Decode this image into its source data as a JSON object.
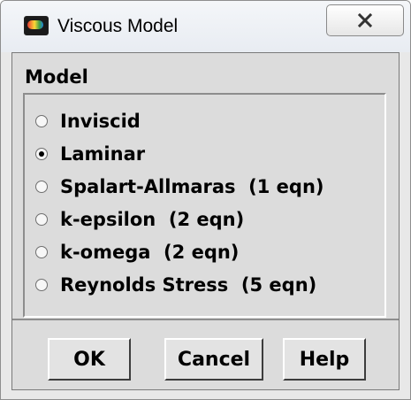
{
  "window": {
    "title": "Viscous Model",
    "close_symbol": "☒"
  },
  "model": {
    "label": "Model",
    "selected": "Laminar",
    "options": [
      {
        "label": "Inviscid",
        "checked": false
      },
      {
        "label": "Laminar",
        "checked": true
      },
      {
        "label": "Spalart-Allmaras  (1 eqn)",
        "checked": false
      },
      {
        "label": "k-epsilon  (2 eqn)",
        "checked": false
      },
      {
        "label": "k-omega  (2 eqn)",
        "checked": false
      },
      {
        "label": "Reynolds Stress  (5 eqn)",
        "checked": false
      }
    ]
  },
  "buttons": {
    "ok": "OK",
    "cancel": "Cancel",
    "help": "Help"
  }
}
